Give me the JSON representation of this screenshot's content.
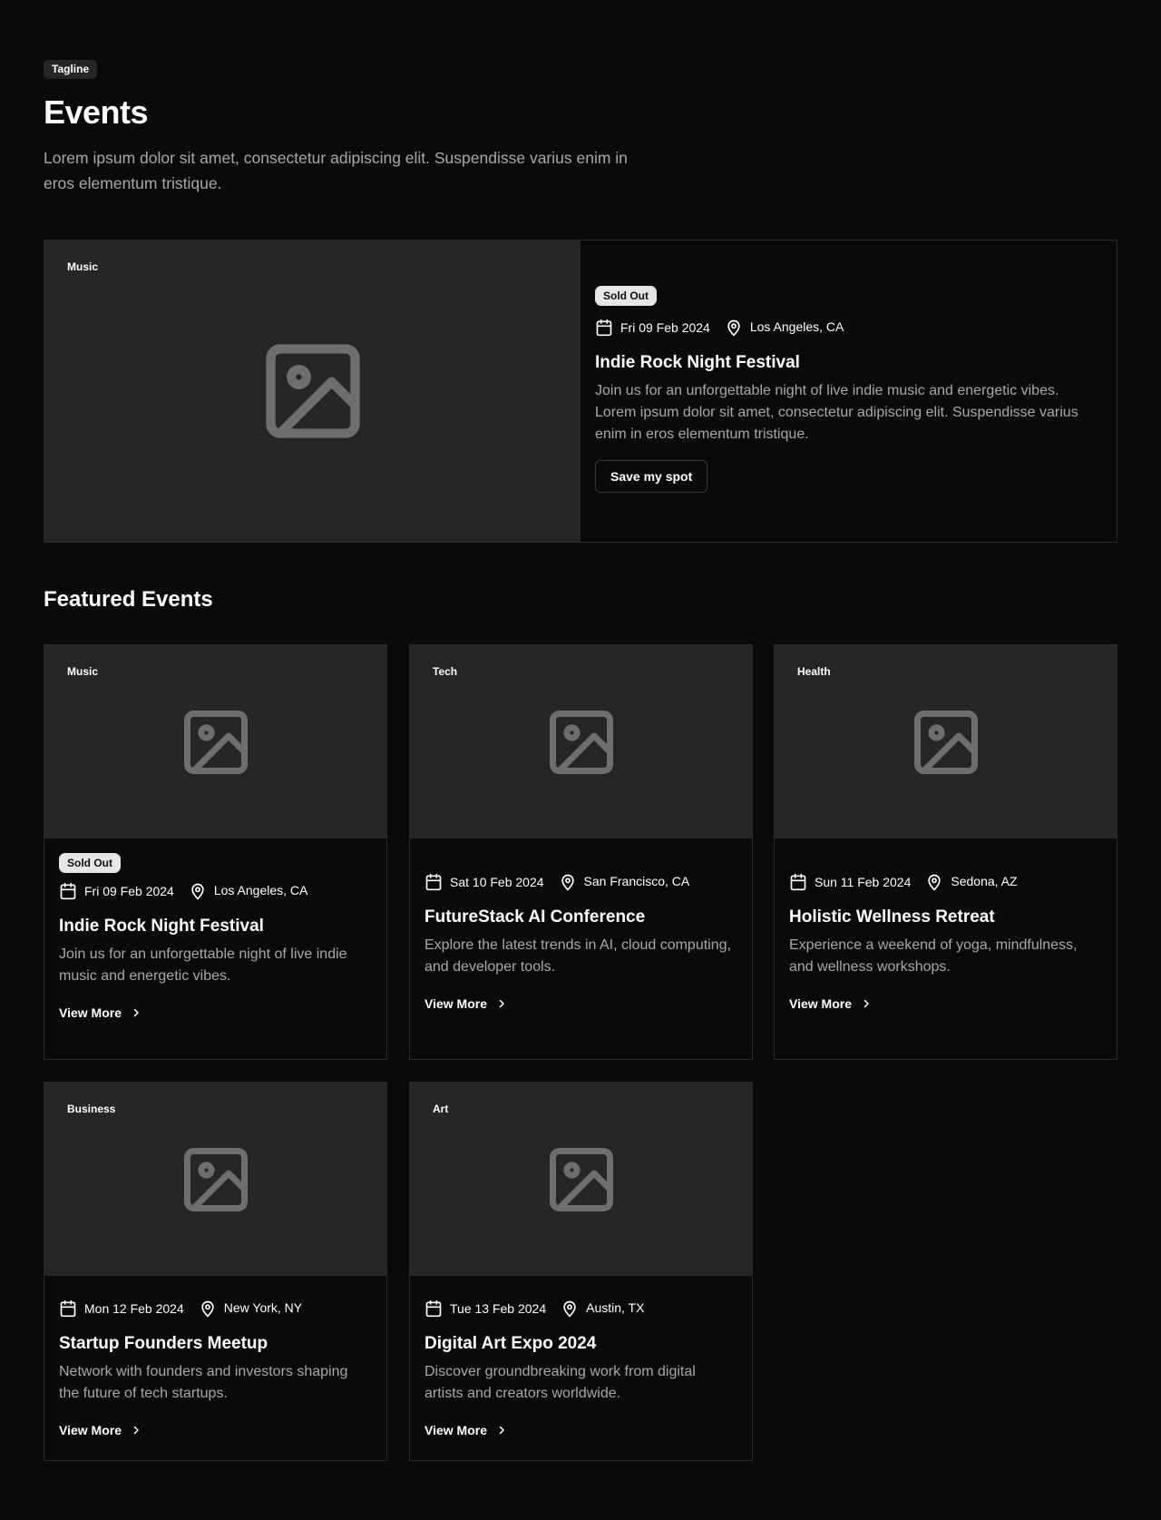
{
  "header": {
    "tagline": "Tagline",
    "title": "Events",
    "description": "Lorem ipsum dolor sit amet, consectetur adipiscing elit. Suspendisse varius enim in eros elementum tristique."
  },
  "hero": {
    "category": "Music",
    "badge": "Sold Out",
    "date": "Fri 09 Feb 2024",
    "location": "Los Angeles, CA",
    "title": "Indie Rock Night Festival",
    "description": "Join us for an unforgettable night of live indie music and energetic vibes. Lorem ipsum dolor sit amet, consectetur adipiscing elit. Suspendisse varius enim in eros elementum tristique.",
    "button_label": "Save my spot"
  },
  "featured": {
    "title": "Featured Events",
    "view_more_label": "View More",
    "cards": [
      {
        "category": "Music",
        "badge": "Sold Out",
        "date": "Fri 09 Feb 2024",
        "location": "Los Angeles, CA",
        "title": "Indie Rock Night Festival",
        "description": "Join us for an unforgettable night of live indie music and energetic vibes."
      },
      {
        "category": "Tech",
        "date": "Sat 10 Feb 2024",
        "location": "San Francisco, CA",
        "title": "FutureStack AI Conference",
        "description": "Explore the latest trends in AI, cloud computing, and developer tools."
      },
      {
        "category": "Health",
        "date": "Sun 11 Feb 2024",
        "location": "Sedona, AZ",
        "title": "Holistic Wellness Retreat",
        "description": "Experience a weekend of yoga, mindfulness, and wellness workshops."
      },
      {
        "category": "Business",
        "date": "Mon 12 Feb 2024",
        "location": "New York, NY",
        "title": "Startup Founders Meetup",
        "description": "Network with founders and investors shaping the future of tech startups."
      },
      {
        "category": "Art",
        "date": "Tue 13 Feb 2024",
        "location": "Austin, TX",
        "title": "Digital Art Expo 2024",
        "description": "Discover groundbreaking work from digital artists and creators worldwide."
      }
    ]
  },
  "icons": {
    "image_placeholder": "image-placeholder-icon",
    "calendar": "calendar-icon",
    "location": "map-pin-icon",
    "chevron": "chevron-right-icon"
  },
  "colors": {
    "background": "#0a0a0a",
    "card_media": "#262626",
    "border": "#2a2a2a",
    "muted_text": "#a8a8a8",
    "badge_bg": "#e6e6e6"
  }
}
